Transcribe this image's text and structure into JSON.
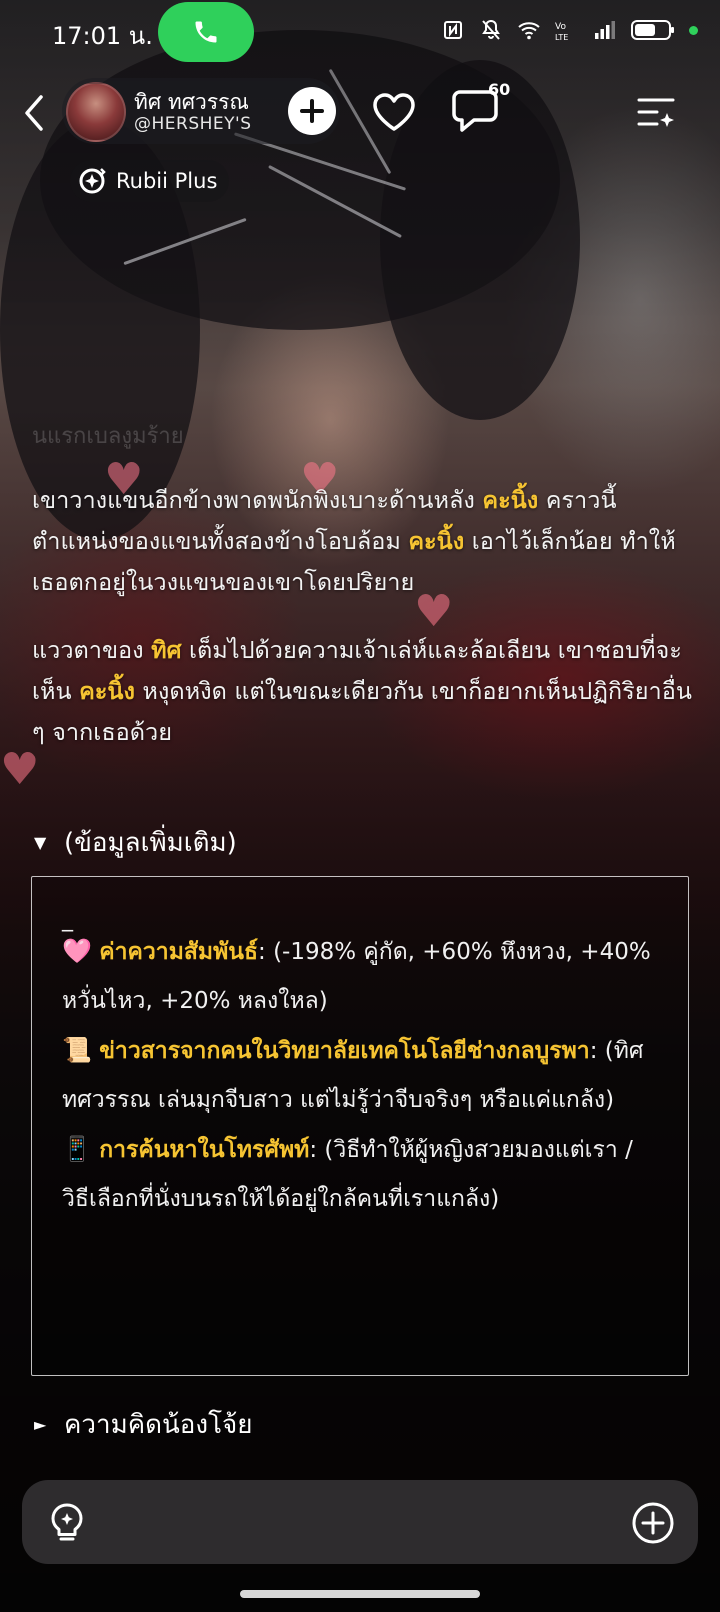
{
  "status_bar": {
    "time": "17:01 น."
  },
  "header": {
    "profile_name": "ทิศ ทศวรรณ",
    "profile_handle": "@HERSHEY'S",
    "comment_count": "60",
    "badge_label": "Rubii Plus"
  },
  "story": {
    "faded_line": "นแรกเบลงูมร้าย",
    "paragraph_1": [
      {
        "text": "เขาวางแขนอีกข้างพาดพนักพิงเบาะด้านหลัง ",
        "highlight": false
      },
      {
        "text": "คะนิ้ง",
        "highlight": true
      },
      {
        "text": " คราวนี้ตำแหน่งของแขนทั้งสองข้างโอบล้อม ",
        "highlight": false
      },
      {
        "text": "คะนิ้ง",
        "highlight": true
      },
      {
        "text": " เอาไว้เล็กน้อย ทำให้เธอตกอยู่ในวงแขนของเขาโดยปริยาย",
        "highlight": false
      }
    ],
    "paragraph_2": [
      {
        "text": "แววตาของ ",
        "highlight": false
      },
      {
        "text": "ทิศ",
        "highlight": true
      },
      {
        "text": " เต็มไปด้วยความเจ้าเล่ห์และล้อเลียน เขาชอบที่จะเห็น ",
        "highlight": false
      },
      {
        "text": "คะนิ้ง",
        "highlight": true
      },
      {
        "text": " หงุดหงิด แต่ในขณะเดียวกัน เขาก็อยากเห็นปฏิกิริยาอื่น ๆ จากเธอด้วย",
        "highlight": false
      }
    ]
  },
  "extra_info": {
    "toggle_label": "(ข้อมูลเพิ่มเติม)",
    "toggle_arrow": "▼",
    "dash": "_",
    "items": [
      {
        "emoji": "🩷",
        "key": "ค่าความสัมพันธ์",
        "value": ": (-198% คู่กัด, +60% หึงหวง, +40% หวั่นไหว, +20% หลงใหล)",
        "line_break_value": [
          "(-198% คู่กัด, +60% หึงหวง,",
          "+40% หวั่นไหว, +20% หลงใหล)"
        ]
      },
      {
        "emoji": "📜",
        "key": "ข่าวสารจากคนในวิทยาลัยเทคโนโลยีช่างกลบูรพา",
        "value": ": (ทิศ ทศวรรณ เล่นมุกจีบสาว แต่ไม่รู้ว่าจีบจริงๆ หรือแค่แกล้ง)"
      },
      {
        "emoji": "📱",
        "key": "การค้นหาในโทรศัพท์",
        "value": ": (วิธีทำให้ผู้หญิงสวยมองแต่เรา / วิธีเลือกที่นั่งบนรถให้ได้อยู่ใกล้คนที่เราแกล้ง)"
      }
    ]
  },
  "thoughts": {
    "toggle_label": "ความคิดน้องโจ้ย",
    "toggle_arrow": "►"
  },
  "icons": {
    "call": "phone-icon",
    "back": "chevron-left-icon",
    "follow": "plus-icon",
    "like": "heart-icon",
    "comment": "chat-bubble-icon",
    "menu": "menu-sparkle-icon",
    "badge": "rubii-plus-icon",
    "hint": "lightbulb-icon",
    "add": "plus-circle-icon"
  },
  "colors": {
    "highlight": "#f6c432",
    "call_pill": "#2fd05b",
    "status_dot": "#2fd05b"
  }
}
